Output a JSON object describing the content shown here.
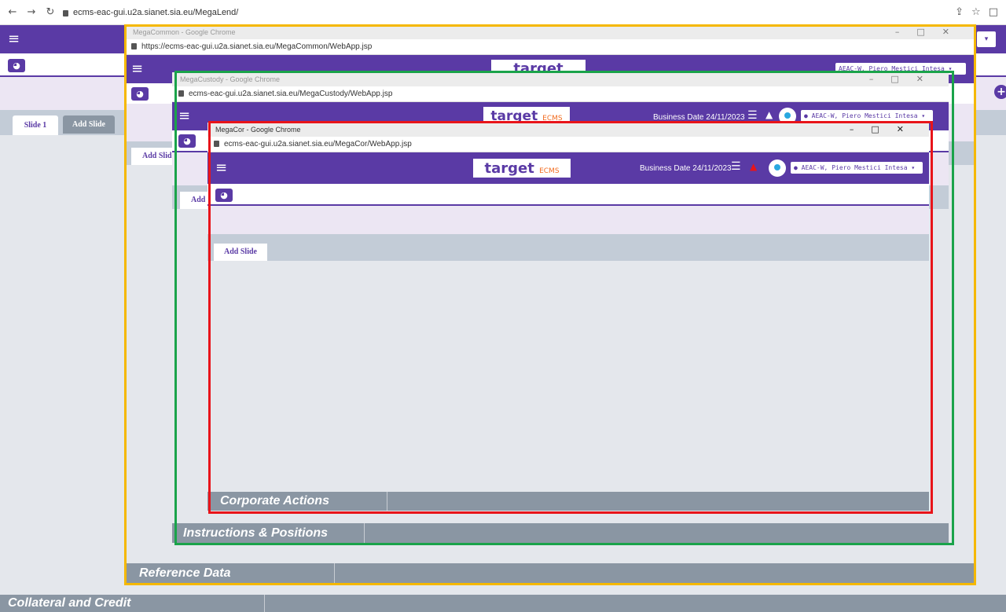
{
  "browser": {
    "url": "ecms-eac-gui.u2a.sianet.sia.eu/MegaLend/"
  },
  "main": {
    "tabs": [
      "Slide 1",
      "Add Slide"
    ],
    "footer_title": "Collateral and Credit"
  },
  "win_common": {
    "title": "MegaCommon - Google Chrome",
    "url": "https://ecms-eac-gui.u2a.sianet.sia.eu/MegaCommon/WebApp.jsp",
    "tab_label": "Add Slide",
    "footer_title": "Reference Data",
    "user_label": "AEAC-W, Piero Mestici Intesa"
  },
  "win_custody": {
    "title": "MegaCustody - Google Chrome",
    "url": "ecms-eac-gui.u2a.sianet.sia.eu/MegaCustody/WebApp.jsp",
    "business_date": "Business Date 24/11/2023",
    "user_label": "AEAC-W, Piero Mestici Intesa",
    "tab_label": "Add S",
    "footer_title": "Instructions & Positions"
  },
  "win_cor": {
    "title": "MegaCor - Google Chrome",
    "url": "ecms-eac-gui.u2a.sianet.sia.eu/MegaCor/WebApp.jsp",
    "business_date": "Business Date 24/11/2023",
    "user_label": "AEAC-W, Piero Mestici Intesa",
    "tab_label": "Add Slide",
    "footer_title": "Corporate Actions"
  },
  "logo": {
    "main": "target",
    "sub": "ECMS"
  },
  "colors": {
    "purple": "#5a3aa5",
    "frame_yellow": "#f5b800",
    "frame_green": "#1aa34a",
    "frame_red": "#e8141a"
  },
  "icons": [
    "back-arrow-icon",
    "forward-arrow-icon",
    "reload-icon",
    "lock-icon",
    "share-icon",
    "star-icon",
    "window-icon",
    "menu-icon",
    "dashboard-icon",
    "plus-circle-icon",
    "list-icon",
    "bell-icon",
    "user-avatar-icon",
    "user-icon",
    "caret-down-icon",
    "minimize-icon",
    "maximize-icon",
    "close-icon"
  ]
}
